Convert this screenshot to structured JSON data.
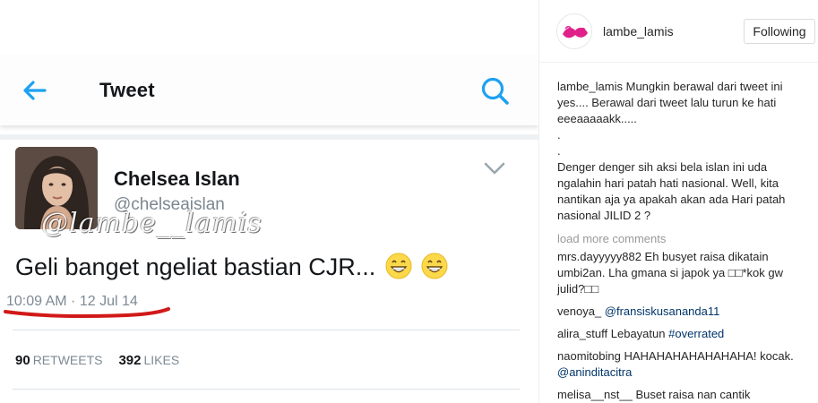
{
  "tweet": {
    "header_title": "Tweet",
    "name": "Chelsea Islan",
    "handle": "@chelseaislan",
    "text": "Geli banget ngeliat bastian CJR...",
    "datetime": "10:09 AM · 12 Jul 14",
    "retweets_count": "90",
    "retweets_label": "RETWEETS",
    "likes_count": "392",
    "likes_label": "LIKES",
    "watermark": "@lambe__lamis"
  },
  "instagram": {
    "username": "lambe_lamis",
    "follow_label": "Following",
    "caption_user": "lambe_lamis",
    "caption_line1": "Mungkin berawal dari tweet ini yes.... Berawal dari tweet lalu turun ke hati eeeaaaaakk.....",
    "caption_dot1": ".",
    "caption_dot2": ".",
    "caption_line2": "Denger denger sih aksi bela islan ini uda ngalahin hari patah hati nasional. Well, kita nantikan aja ya apakah akan ada Hari patah nasional JILID 2 ?",
    "load_more": "load more comments",
    "comments": [
      {
        "user": "mrs.dayyyyy882",
        "text": "Eh busyet raisa dikatain umbi2an. Lha gmana si japok ya □□*kok gw julid?□□",
        "mention": ""
      },
      {
        "user": "venoya_",
        "text": "",
        "mention": "@fransiskusananda11"
      },
      {
        "user": "alira_stuff",
        "text": "Lebayatun",
        "mention": "#overrated"
      },
      {
        "user": "naomitobing",
        "text": "HAHAHAHAHAHAHAHA! kocak.",
        "mention": "@aninditacitra"
      },
      {
        "user": "melisa__nst__",
        "text": "Buset raisa nan cantik",
        "mention": ""
      }
    ]
  }
}
